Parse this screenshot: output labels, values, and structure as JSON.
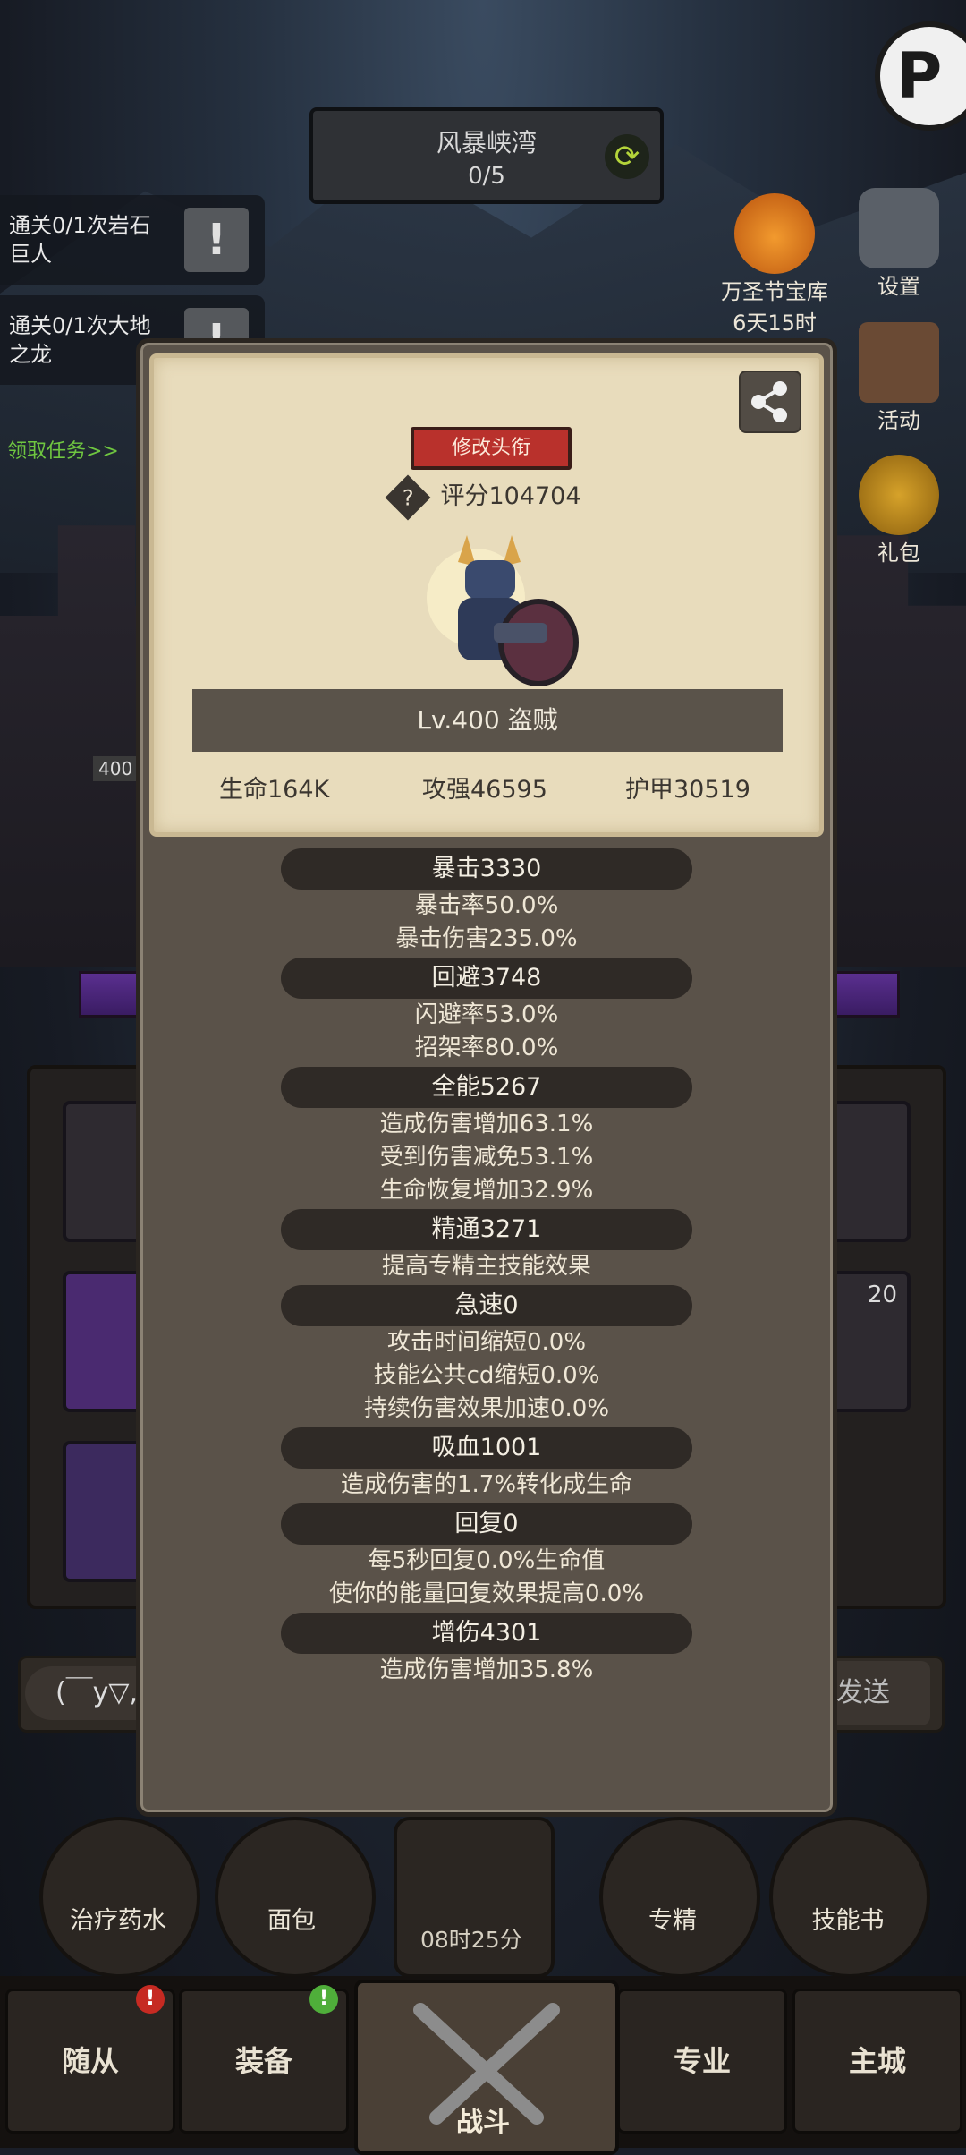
{
  "hud": {
    "map_name": "风暴峡湾",
    "map_progress": "0/5",
    "quests": [
      "通关0/1次岩石巨人",
      "通关0/1次大地之龙"
    ],
    "quest_link": "领取任务>>",
    "event_name": "万圣节宝库",
    "event_time": "6天15时",
    "side_buttons": [
      "设置",
      "活动",
      "礼包"
    ],
    "level_badge": "400"
  },
  "modal": {
    "title_button": "修改头衔",
    "score": "评分104704",
    "level_class": "Lv.400 盗贼",
    "base_stats": [
      "生命164K",
      "攻强46595",
      "护甲30519"
    ],
    "stats": [
      {
        "name": "暴击3330",
        "details": [
          "暴击率50.0%",
          "暴击伤害235.0%"
        ]
      },
      {
        "name": "回避3748",
        "details": [
          "闪避率53.0%",
          "招架率80.0%"
        ]
      },
      {
        "name": "全能5267",
        "details": [
          "造成伤害增加63.1%",
          "受到伤害减免53.1%",
          "生命恢复增加32.9%"
        ]
      },
      {
        "name": "精通3271",
        "details": [
          "提高专精主技能效果"
        ]
      },
      {
        "name": "急速0",
        "details": [
          "攻击时间缩短0.0%",
          "技能公共cd缩短0.0%",
          "持续伤害效果加速0.0%"
        ]
      },
      {
        "name": "吸血1001",
        "details": [
          "造成伤害的1.7%转化成生命"
        ]
      },
      {
        "name": "回复0",
        "details": [
          "每5秒回复0.0%生命值",
          "使你的能量回复效果提高0.0%"
        ]
      },
      {
        "name": "增伤4301",
        "details": [
          "造成伤害增加35.8%"
        ]
      }
    ]
  },
  "chat": {
    "emoticon": "(￣y▽,",
    "send": "发送"
  },
  "bottom": {
    "skills": [
      "治疗药水",
      "面包",
      "专精",
      "技能书"
    ],
    "timer": "08时25分",
    "slot_count": "20",
    "nav": [
      "随从",
      "装备",
      "战斗",
      "专业",
      "主城"
    ]
  },
  "colors": {
    "accent_red": "#b9312c",
    "card_bg": "#e8dcbc",
    "modal_bg": "#5a5249",
    "quest_green": "#6fc640"
  }
}
